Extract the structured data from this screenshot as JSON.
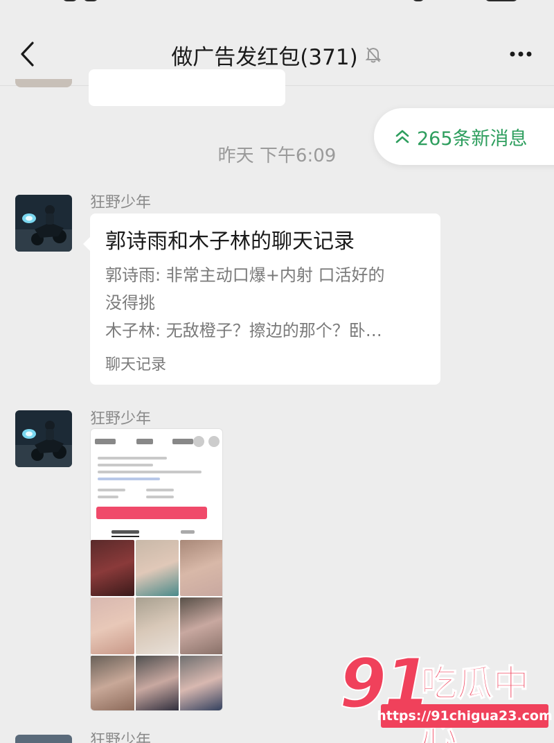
{
  "header": {
    "title": "做广告发红包(371)",
    "back_icon": "chevron-left-icon",
    "mute_icon": "bell-off-icon",
    "more_icon": "more-dots-icon"
  },
  "new_messages": {
    "label": "265条新消息",
    "icon": "double-chevron-up-icon",
    "color": "#2e9e5e"
  },
  "timestamp": "昨天 下午6:09",
  "messages": [
    {
      "sender": "狂野少年",
      "type": "chat-record",
      "title": "郭诗雨和木子林的聊天记录",
      "lines": [
        "郭诗雨: 非常主动口爆+内射 口活好的",
        "没得挑",
        "木子林: 无敌橙子？擦边的那个？卧…"
      ],
      "footer": "聊天记录"
    },
    {
      "sender": "狂野少年",
      "type": "image"
    },
    {
      "sender": "狂野少年",
      "type": "partial"
    }
  ],
  "watermark": {
    "number": "91",
    "text": "吃瓜中心",
    "url": "https://91chigua23.com",
    "color": "#f0415b"
  }
}
